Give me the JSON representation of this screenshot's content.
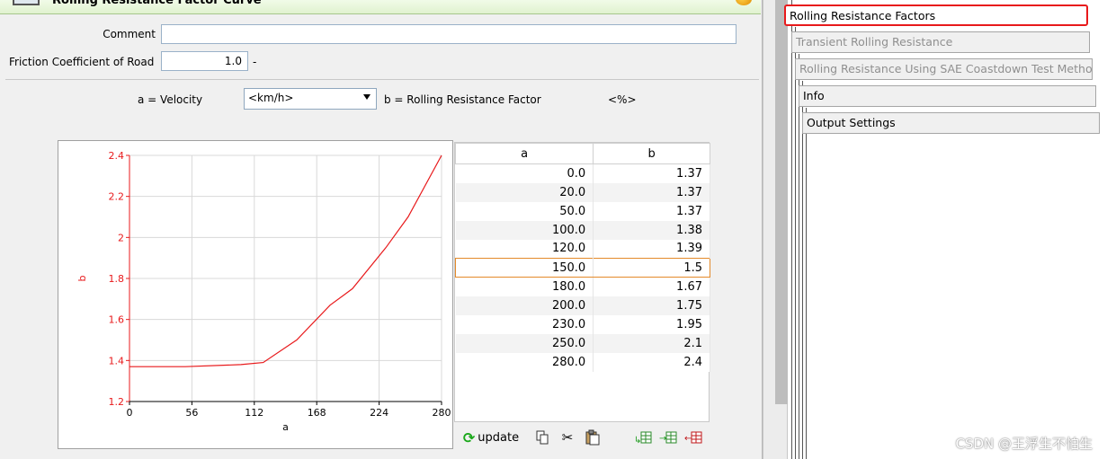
{
  "window": {
    "title": "Rolling Resistance Factor Curve"
  },
  "form": {
    "comment_label": "Comment",
    "comment_value": "",
    "friction_label": "Friction Coefficient of Road",
    "friction_value": "1.0",
    "friction_unit": "-"
  },
  "definition": {
    "a_def": "a = Velocity",
    "unit_selected": "<km/h>",
    "b_def": "b = Rolling Resistance Factor",
    "b_unit": "<%>"
  },
  "table": {
    "headers": [
      "a",
      "b"
    ],
    "rows": [
      [
        "0.0",
        "1.37"
      ],
      [
        "20.0",
        "1.37"
      ],
      [
        "50.0",
        "1.37"
      ],
      [
        "100.0",
        "1.38"
      ],
      [
        "120.0",
        "1.39"
      ],
      [
        "150.0",
        "1.5"
      ],
      [
        "180.0",
        "1.67"
      ],
      [
        "200.0",
        "1.75"
      ],
      [
        "230.0",
        "1.95"
      ],
      [
        "250.0",
        "2.1"
      ],
      [
        "280.0",
        "2.4"
      ]
    ],
    "selected_row": 5
  },
  "toolbar": {
    "update_label": "update",
    "icons": [
      "copy-icon",
      "cut-icon",
      "paste-icon",
      "insert-row-before-icon",
      "insert-row-after-icon",
      "delete-row-icon"
    ]
  },
  "chart_data": {
    "type": "line",
    "x": [
      0,
      20,
      50,
      100,
      120,
      150,
      180,
      200,
      230,
      250,
      280
    ],
    "series": [
      {
        "values": [
          1.37,
          1.37,
          1.37,
          1.38,
          1.39,
          1.5,
          1.67,
          1.75,
          1.95,
          2.1,
          2.4
        ],
        "color": "#e8191b"
      }
    ],
    "xlabel": "a",
    "ylabel": "b",
    "xlim": [
      0,
      280
    ],
    "ylim": [
      1.2,
      2.4
    ],
    "xticks": [
      0,
      56,
      112,
      168,
      224,
      280
    ],
    "yticks": [
      1.2,
      1.4,
      1.6,
      1.8,
      2,
      2.2,
      2.4
    ],
    "grid": true,
    "axis_color": "#e8191b"
  },
  "nav": {
    "items": [
      {
        "label": "Rolling Resistance Factors",
        "state": "selected"
      },
      {
        "label": "Transient Rolling Resistance",
        "state": "disabled"
      },
      {
        "label": "Rolling Resistance Using SAE Coastdown Test Method",
        "state": "disabled"
      },
      {
        "label": "Info",
        "state": "normal"
      },
      {
        "label": "Output Settings",
        "state": "normal"
      }
    ]
  },
  "watermark": "CSDN @王浮生不怕生"
}
